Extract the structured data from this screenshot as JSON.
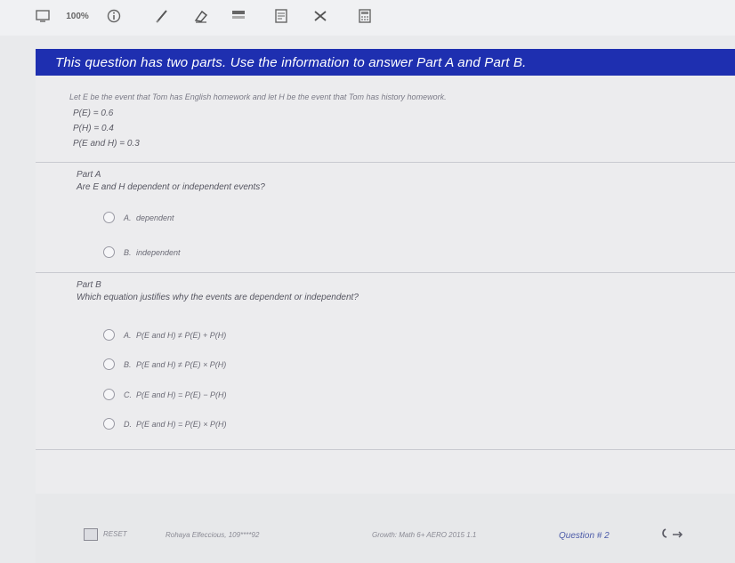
{
  "toolbar": {
    "zoom": "100%",
    "icons": [
      "display-icon",
      "info-icon",
      "pen-icon",
      "eraser-icon",
      "highlighter-icon",
      "notepad-icon",
      "strikethrough-icon",
      "calculator-icon"
    ]
  },
  "banner": {
    "text": "This question has two parts. Use the information to answer Part A and Part B."
  },
  "intro": "Let E be the event that Tom has English homework and let H be the event that Tom has history homework.",
  "given": [
    "P(E) = 0.6",
    "P(H) = 0.4",
    "P(E and H) = 0.3"
  ],
  "part_a": {
    "label": "Part A",
    "question": "Are E and H dependent or independent events?",
    "options": [
      {
        "letter": "A.",
        "text": "dependent"
      },
      {
        "letter": "B.",
        "text": "independent"
      }
    ]
  },
  "part_b": {
    "label": "Part B",
    "question": "Which equation justifies why the events are dependent or independent?",
    "options": [
      {
        "letter": "A.",
        "text": "P(E and H) ≠ P(E) + P(H)"
      },
      {
        "letter": "B.",
        "text": "P(E and H) ≠ P(E) × P(H)"
      },
      {
        "letter": "C.",
        "text": "P(E and H) = P(E) − P(H)"
      },
      {
        "letter": "D.",
        "text": "P(E and H) = P(E) × P(H)"
      }
    ]
  },
  "footer": {
    "reset": "RESET",
    "student": "Rohaya Elfeccious, 109****92",
    "course": "Growth: Math 6+ AERO 2015 1.1",
    "question": "Question # 2"
  },
  "colors": {
    "banner_bg": "#1e2fb0",
    "page_bg": "#e9eaec",
    "question_number": "#4b5aa8"
  }
}
